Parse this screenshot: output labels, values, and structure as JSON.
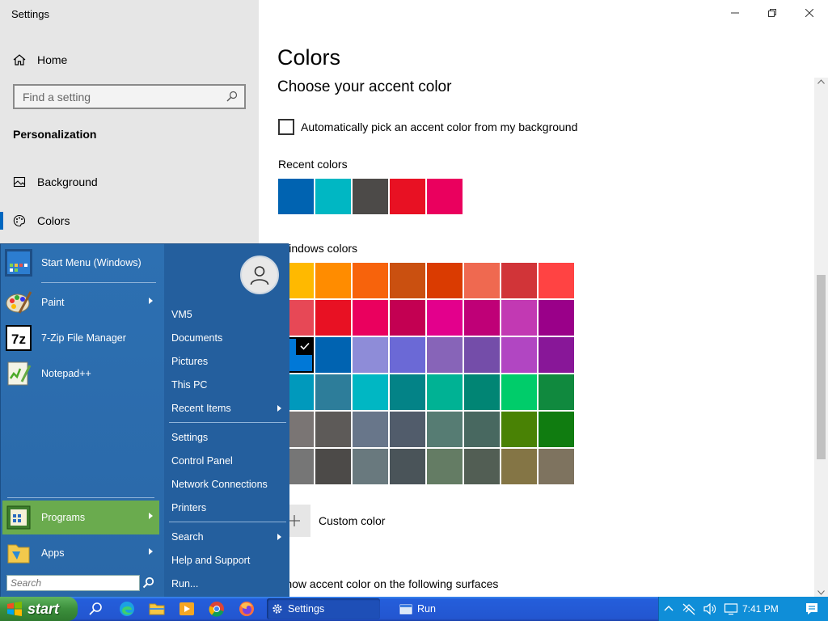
{
  "window": {
    "title": "Settings",
    "controls": [
      "minimize-icon",
      "restore-icon",
      "close-icon"
    ]
  },
  "nav": {
    "home_label": "Home",
    "search_placeholder": "Find a setting",
    "section": "Personalization",
    "items": [
      {
        "label": "Background",
        "icon": "picture-icon"
      },
      {
        "label": "Colors",
        "icon": "palette-icon",
        "selected": true
      }
    ]
  },
  "content": {
    "title": "Colors",
    "subtitle": "Choose your accent color",
    "auto_pick_label": "Automatically pick an accent color from my background",
    "auto_pick_checked": false,
    "recent_label": "Recent colors",
    "recent_colors": [
      "#0063B1",
      "#00B7C3",
      "#4C4A48",
      "#E81123",
      "#EA005E"
    ],
    "windows_label": "Windows colors",
    "windows_colors": [
      "#FFB900",
      "#FF8C00",
      "#F7630C",
      "#CA5010",
      "#DA3B01",
      "#EF6950",
      "#D13438",
      "#FF4343",
      "#E74856",
      "#E81123",
      "#EA005E",
      "#C30052",
      "#E3008C",
      "#BF0077",
      "#C239B3",
      "#9A0089",
      "#0078D7",
      "#0063B1",
      "#8E8CD8",
      "#6B69D6",
      "#8764B8",
      "#744DA9",
      "#B146C2",
      "#881798",
      "#0099BC",
      "#2D7D9A",
      "#00B7C3",
      "#038387",
      "#00B294",
      "#018574",
      "#00CC6A",
      "#10893E",
      "#7A7574",
      "#5D5A58",
      "#68768A",
      "#515C6B",
      "#567C73",
      "#486860",
      "#498205",
      "#107C10",
      "#767676",
      "#4C4A48",
      "#69797E",
      "#4A5459",
      "#647C64",
      "#525E54",
      "#847545",
      "#7E735F"
    ],
    "selected_index": 16,
    "custom_label": "Custom color",
    "surfaces_label": "Show accent color on the following surfaces"
  },
  "start_menu": {
    "pinned": [
      {
        "label": "Start Menu (Windows)",
        "icon": "start-menu-app-icon",
        "arrow": false
      },
      {
        "label": "Paint",
        "icon": "paint-icon",
        "arrow": true
      },
      {
        "label": "7-Zip File Manager",
        "icon": "7zip-icon",
        "arrow": false
      },
      {
        "label": "Notepad++",
        "icon": "notepad-icon",
        "arrow": false
      }
    ],
    "programs_label": "Programs",
    "apps_label": "Apps",
    "search_placeholder": "Search",
    "right_items": [
      {
        "label": "VM5",
        "arrow": false
      },
      {
        "label": "Documents",
        "arrow": false
      },
      {
        "label": "Pictures",
        "arrow": false
      },
      {
        "label": "This PC",
        "arrow": false
      },
      {
        "label": "Recent Items",
        "arrow": true
      },
      {
        "label": "Settings",
        "arrow": false
      },
      {
        "label": "Control Panel",
        "arrow": false
      },
      {
        "label": "Network Connections",
        "arrow": false
      },
      {
        "label": "Printers",
        "arrow": false
      },
      {
        "label": "Search",
        "arrow": true
      },
      {
        "label": "Help and Support",
        "arrow": false
      },
      {
        "label": "Run...",
        "arrow": false
      }
    ]
  },
  "taskbar": {
    "start_label": "start",
    "quick_launch": [
      "search-icon",
      "edge-icon",
      "file-explorer-icon",
      "media-player-icon",
      "chrome-icon",
      "firefox-icon"
    ],
    "tasks": [
      {
        "label": "Settings",
        "icon": "gear-icon",
        "active": true
      },
      {
        "label": "Run",
        "icon": "run-icon",
        "active": false
      }
    ],
    "tray_icons": [
      "chevron-up-icon",
      "network-off-icon",
      "volume-icon",
      "display-icon"
    ],
    "time": "7:41 PM",
    "notification_icon": "notification-icon"
  }
}
